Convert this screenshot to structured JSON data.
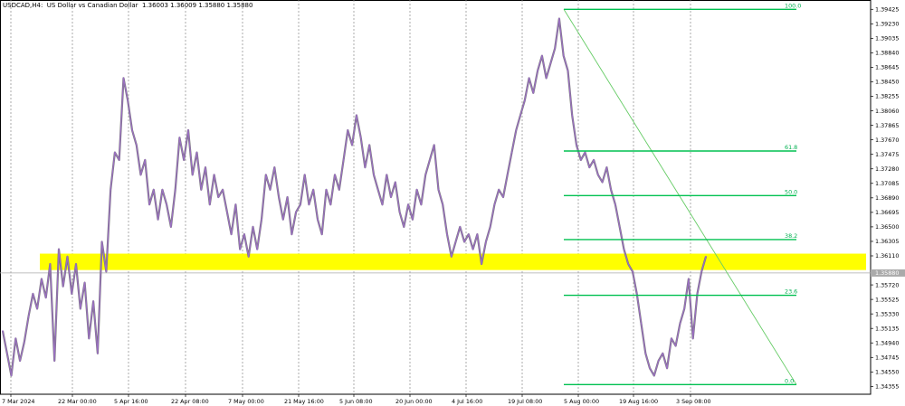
{
  "header": {
    "symbol": "USDCAD,H4",
    "description": "US Dollar vs Canadian Dollar",
    "ohlc": "1.36003 1.36009 1.35880 1.35880"
  },
  "chart_data": {
    "type": "line",
    "title": "USDCAD,H4:  US Dollar vs Canadian Dollar  1.36003 1.36009 1.35880 1.35880",
    "xlabel": "",
    "ylabel": "",
    "ylim": [
      1.3425,
      1.3955
    ],
    "grid": "vertical-dotted",
    "x_ticks": [
      "7 Mar 2024",
      "22 Mar 00:00",
      "5 Apr 16:00",
      "22 Apr 08:00",
      "7 May 00:00",
      "21 May 16:00",
      "5 Jun 08:00",
      "20 Jun 00:00",
      "4 Jul 16:00",
      "19 Jul 08:00",
      "5 Aug 00:00",
      "19 Aug 16:00",
      "3 Sep 08:00"
    ],
    "y_ticks": [
      1.39425,
      1.3923,
      1.39035,
      1.3884,
      1.38645,
      1.3845,
      1.38255,
      1.3806,
      1.37865,
      1.3767,
      1.37475,
      1.3728,
      1.37085,
      1.3689,
      1.36695,
      1.365,
      1.36305,
      1.3611,
      1.3572,
      1.35525,
      1.3533,
      1.35135,
      1.3494,
      1.34745,
      1.3455,
      1.34355
    ],
    "current_price": 1.3588,
    "current_price_label": "1.35880",
    "series": [
      {
        "color": "#9b6fc4",
        "values": [
          1.351,
          1.348,
          1.345,
          1.35,
          1.347,
          1.3495,
          1.353,
          1.356,
          1.354,
          1.358,
          1.3555,
          1.36,
          1.347,
          1.362,
          1.357,
          1.361,
          1.356,
          1.36,
          1.354,
          1.3575,
          1.35,
          1.355,
          1.348,
          1.363,
          1.359,
          1.37,
          1.375,
          1.374,
          1.385,
          1.382,
          1.378,
          1.376,
          1.372,
          1.374,
          1.368,
          1.37,
          1.366,
          1.37,
          1.368,
          1.365,
          1.37,
          1.377,
          1.374,
          1.378,
          1.372,
          1.375,
          1.37,
          1.373,
          1.368,
          1.372,
          1.369,
          1.37,
          1.367,
          1.364,
          1.368,
          1.362,
          1.364,
          1.361,
          1.365,
          1.362,
          1.366,
          1.372,
          1.37,
          1.373,
          1.369,
          1.366,
          1.369,
          1.364,
          1.367,
          1.368,
          1.372,
          1.368,
          1.37,
          1.366,
          1.364,
          1.37,
          1.368,
          1.372,
          1.37,
          1.374,
          1.378,
          1.376,
          1.38,
          1.377,
          1.373,
          1.376,
          1.372,
          1.37,
          1.368,
          1.372,
          1.369,
          1.371,
          1.367,
          1.365,
          1.368,
          1.366,
          1.37,
          1.368,
          1.372,
          1.374,
          1.376,
          1.37,
          1.368,
          1.364,
          1.361,
          1.363,
          1.365,
          1.363,
          1.364,
          1.362,
          1.364,
          1.36,
          1.363,
          1.365,
          1.368,
          1.37,
          1.369,
          1.372,
          1.375,
          1.378,
          1.38,
          1.382,
          1.385,
          1.383,
          1.386,
          1.388,
          1.385,
          1.387,
          1.389,
          1.393,
          1.388,
          1.386,
          1.38,
          1.376,
          1.374,
          1.375,
          1.373,
          1.374,
          1.372,
          1.371,
          1.373,
          1.37,
          1.368,
          1.365,
          1.362,
          1.36,
          1.359,
          1.356,
          1.352,
          1.348,
          1.346,
          1.345,
          1.347,
          1.348,
          1.346,
          1.35,
          1.349,
          1.352,
          1.354,
          1.358,
          1.35,
          1.356,
          1.359,
          1.361
        ]
      }
    ],
    "fib_levels": [
      {
        "label": "100.0",
        "price": 1.39425
      },
      {
        "label": "61.8",
        "price": 1.3752
      },
      {
        "label": "50.0",
        "price": 1.3692
      },
      {
        "label": "38.2",
        "price": 1.3633
      },
      {
        "label": "23.6",
        "price": 1.3558
      },
      {
        "label": "0.0",
        "price": 1.3438
      }
    ],
    "support_zone": {
      "from": 1.3592,
      "to": 1.3614,
      "color": "#ffff00"
    },
    "trendline": {
      "from_date": "5 Aug 00:00",
      "from_price": 1.39425,
      "to_price": 1.3438,
      "color": "#66cc66"
    },
    "fib_color": "#00c050"
  }
}
